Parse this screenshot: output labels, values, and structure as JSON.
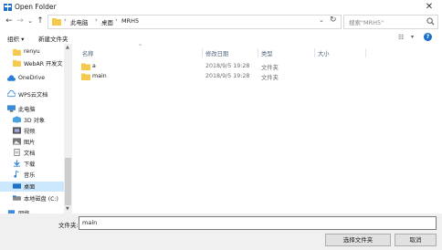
{
  "window": {
    "title": "Open Folder",
    "close_glyph": "✕"
  },
  "nav": {
    "back": "←",
    "forward": "→",
    "dropdown": "⌄",
    "up": "↑",
    "breadcrumb": [
      "此电脑",
      "桌面",
      "MRH5"
    ],
    "separator": "›",
    "refresh": "↻",
    "search_placeholder": "搜索\"MRH5\""
  },
  "toolbar": {
    "organize": "组织 ▾",
    "new_folder": "新建文件夹",
    "view_icon": "☷",
    "view_arrow": "▾",
    "help": "?"
  },
  "sidebar": {
    "items": [
      {
        "label": "renyu",
        "icon": "folder"
      },
      {
        "label": "WebAR 开发文",
        "icon": "folder"
      },
      {
        "label": "OneDrive",
        "icon": "cloud"
      },
      {
        "label": "WPS云文档",
        "icon": "cloud-wps"
      },
      {
        "label": "此电脑",
        "icon": "pc"
      },
      {
        "label": "3D 对象",
        "icon": "3d"
      },
      {
        "label": "视频",
        "icon": "video"
      },
      {
        "label": "图片",
        "icon": "pictures"
      },
      {
        "label": "文档",
        "icon": "documents"
      },
      {
        "label": "下载",
        "icon": "download"
      },
      {
        "label": "音乐",
        "icon": "music"
      },
      {
        "label": "桌面",
        "icon": "desktop",
        "selected": true
      },
      {
        "label": "本地磁盘 (C:)",
        "icon": "disk"
      },
      {
        "label": "网络",
        "icon": "network"
      }
    ]
  },
  "columns": {
    "name": "名称",
    "date": "修改日期",
    "type": "类型",
    "size": "大小",
    "sort_glyph": "^"
  },
  "files": [
    {
      "name": "a",
      "date": "2018/9/5 19:28",
      "type": "文件夹",
      "size": ""
    },
    {
      "name": "main",
      "date": "2018/9/5 19:28",
      "type": "文件夹",
      "size": ""
    }
  ],
  "footer": {
    "filename_label": "文件夹:",
    "filename_value": "main",
    "select_button": "选择文件夹",
    "cancel_button": "取消"
  },
  "colors": {
    "accent": "#0078d7",
    "selection": "#cce8ff",
    "folder": "#f6c94c"
  }
}
